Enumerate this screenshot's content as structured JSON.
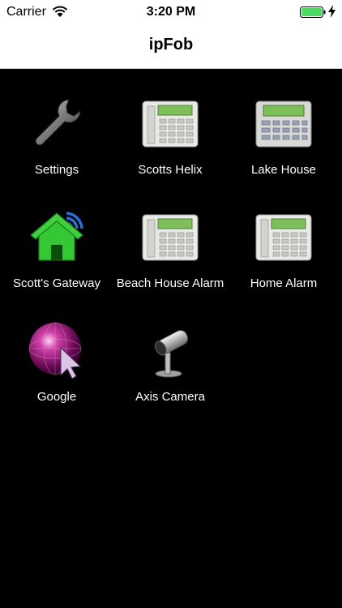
{
  "status_bar": {
    "carrier": "Carrier",
    "time": "3:20 PM",
    "battery_color": "#4cd964"
  },
  "nav": {
    "title": "ipFob"
  },
  "tiles": [
    {
      "label": "Settings",
      "icon": "wrench-icon"
    },
    {
      "label": "Scotts Helix",
      "icon": "alarm-keypad-icon"
    },
    {
      "label": "Lake House",
      "icon": "alarm-keypad-icon"
    },
    {
      "label": "Scott's Gateway",
      "icon": "home-gateway-icon"
    },
    {
      "label": "Beach House Alarm",
      "icon": "alarm-keypad-icon"
    },
    {
      "label": "Home Alarm",
      "icon": "alarm-keypad-icon"
    },
    {
      "label": "Google",
      "icon": "globe-cursor-icon"
    },
    {
      "label": "Axis Camera",
      "icon": "security-camera-icon"
    }
  ]
}
